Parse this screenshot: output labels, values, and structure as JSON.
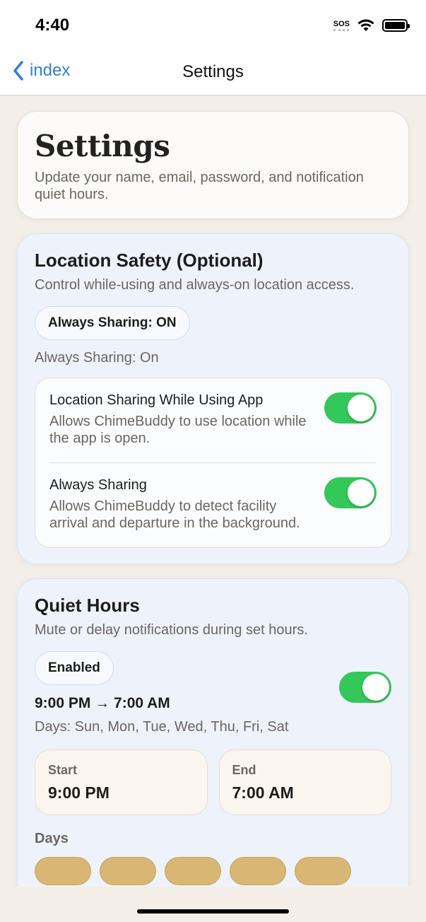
{
  "status_bar": {
    "time": "4:40",
    "sos": "SOS"
  },
  "nav": {
    "back_label": "index",
    "title": "Settings"
  },
  "header_card": {
    "title": "Settings",
    "subtitle": "Update your name, email, password, and notification quiet hours."
  },
  "location": {
    "title": "Location Safety (Optional)",
    "subtitle": "Control while-using and always-on location access.",
    "pill": "Always Sharing: ON",
    "status": "Always Sharing: On",
    "toggles": [
      {
        "label": "Location Sharing While Using App",
        "desc": "Allows ChimeBuddy to use location while the app is open.",
        "on": true
      },
      {
        "label": "Always Sharing",
        "desc": "Allows ChimeBuddy to detect facility arrival and departure in the background.",
        "on": true
      }
    ]
  },
  "quiet_hours": {
    "title": "Quiet Hours",
    "subtitle": "Mute or delay notifications during set hours.",
    "pill": "Enabled",
    "range": "9:00 PM → 7:00 AM",
    "days_line": "Days: Sun, Mon, Tue, Wed, Thu, Fri, Sat",
    "enabled": true,
    "start_label": "Start",
    "start_value": "9:00 PM",
    "end_label": "End",
    "end_value": "7:00 AM",
    "days_title": "Days"
  },
  "colors": {
    "accent": "#2f7fd6",
    "toggle_on": "#34c759",
    "day_chip": "#d8b673"
  }
}
